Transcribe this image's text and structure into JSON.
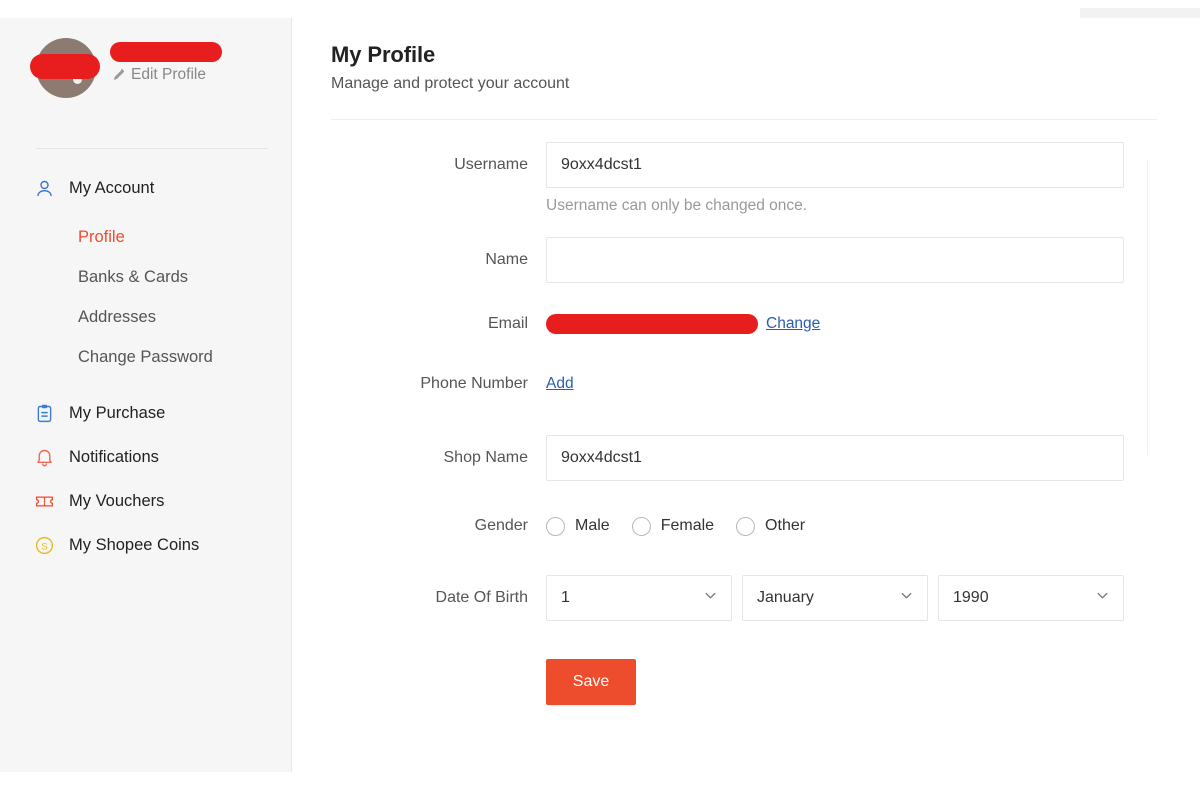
{
  "sidebar": {
    "user": {
      "name_redacted": true,
      "edit_profile_label": "Edit Profile",
      "avatar_icon": "user-avatar"
    },
    "account_group": {
      "label": "My Account",
      "icon": "user-outline-icon",
      "items": [
        {
          "label": "Profile",
          "active": true
        },
        {
          "label": "Banks & Cards",
          "active": false
        },
        {
          "label": "Addresses",
          "active": false
        },
        {
          "label": "Change Password",
          "active": false
        }
      ]
    },
    "items": [
      {
        "label": "My Purchase",
        "icon": "clipboard-icon",
        "color": "#3b7cd4"
      },
      {
        "label": "Notifications",
        "icon": "bell-icon",
        "color": "#ee6a54"
      },
      {
        "label": "My Vouchers",
        "icon": "ticket-icon",
        "color": "#ee4d2d"
      },
      {
        "label": "My Shopee Coins",
        "icon": "coin-icon",
        "color": "#e8b923"
      }
    ]
  },
  "header": {
    "title": "My Profile",
    "subtitle": "Manage and protect your account"
  },
  "form": {
    "username": {
      "label": "Username",
      "value": "9oxx4dcst1",
      "placeholder": "",
      "hint": "Username can only be changed once."
    },
    "name": {
      "label": "Name",
      "value": "",
      "placeholder": ""
    },
    "email": {
      "label": "Email",
      "value_redacted": true,
      "change_link": "Change"
    },
    "phone": {
      "label": "Phone Number",
      "add_link": "Add"
    },
    "shop_name": {
      "label": "Shop Name",
      "value": "9oxx4dcst1",
      "placeholder": ""
    },
    "gender": {
      "label": "Gender",
      "options": [
        {
          "label": "Male",
          "selected": false
        },
        {
          "label": "Female",
          "selected": false
        },
        {
          "label": "Other",
          "selected": false
        }
      ]
    },
    "date_of_birth": {
      "label": "Date Of Birth",
      "day": "1",
      "month": "January",
      "year": "1990"
    },
    "save_label": "Save"
  },
  "colors": {
    "accent": "#ee4d2d",
    "link": "#2a5db0",
    "redaction": "#e81d1d",
    "sidebar_bg": "#f6f6f6"
  }
}
